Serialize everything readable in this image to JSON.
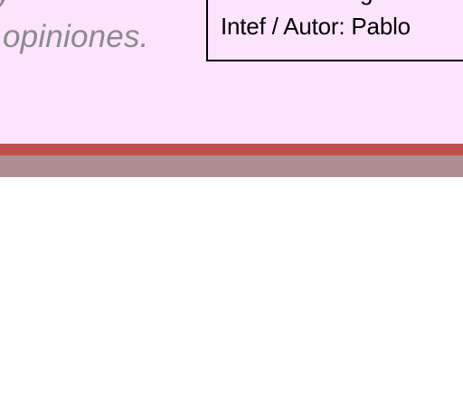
{
  "slide": {
    "quote_fragment": "y",
    "quote_text": "opiniones.",
    "credit_fragment": "g",
    "credit_text": "Intef / Autor: Pablo"
  },
  "colors": {
    "slide_background": "#fde4fd",
    "quote_text": "#8a8a8a",
    "band_red": "#c0504d",
    "band_mauve": "#af9092",
    "page_background": "#ffffff"
  }
}
